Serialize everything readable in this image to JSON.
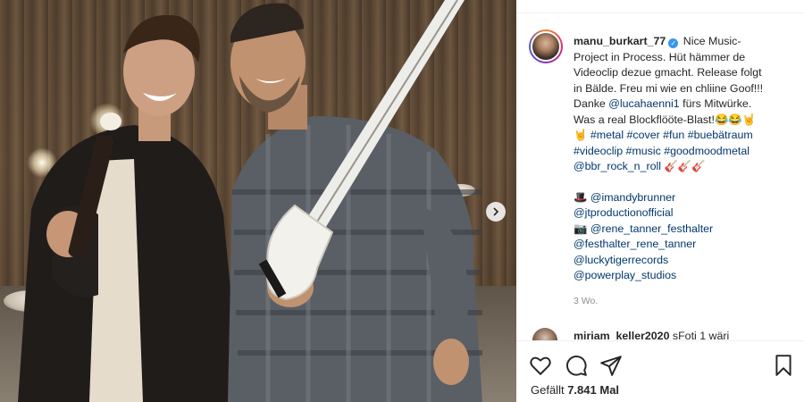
{
  "post": {
    "username": "manu_burkart_77",
    "caption_lines": [
      "Nice Music-",
      "Project in Process. Hüt hämmer de",
      "Videoclip dezue gmacht. Release folgt",
      "in Bälde. Freu mi wie en chliine Goof!!!",
      "Danke",
      "fürs Mitwürke.",
      "Was a real Blockflööte-Blast!"
    ],
    "mention_1": "@lucahaenni1",
    "emoji_laugh": "😂😂🤘",
    "emoji_horns": "🤘",
    "hashtags_line1": "#metal #cover #fun #buebätraum",
    "hashtags_line2": "#videoclip #music #goodmoodmetal",
    "bbr": "@bbr_rock_n_roll",
    "guitars": "🎸🎸🎸",
    "credits": [
      {
        "emoji": "🎩",
        "handle": "@imandybrunner"
      },
      {
        "emoji": "",
        "handle": "@jtproductionofficial"
      },
      {
        "emoji": "📷",
        "handle": "@rene_tanner_festhalter"
      },
      {
        "emoji": "",
        "handle": "@festhalter_rene_tanner"
      },
      {
        "emoji": "",
        "handle": "@luckytigerrecords"
      },
      {
        "emoji": "",
        "handle": "@powerplay_studios"
      }
    ],
    "time_ago": "3 Wo."
  },
  "comment_preview": {
    "username": "miriam_keller2020",
    "text": "sFoti 1 wäri",
    "more": "..."
  },
  "actions": {
    "likes_prefix": "Gefällt",
    "likes_count": "7.841",
    "likes_suffix": "Mal",
    "icons": [
      "heart-icon",
      "comment-icon",
      "share-icon",
      "bookmark-icon"
    ]
  },
  "colors": {
    "link": "#00376b",
    "verified": "#3897f0",
    "muted": "#8e8e8e"
  }
}
